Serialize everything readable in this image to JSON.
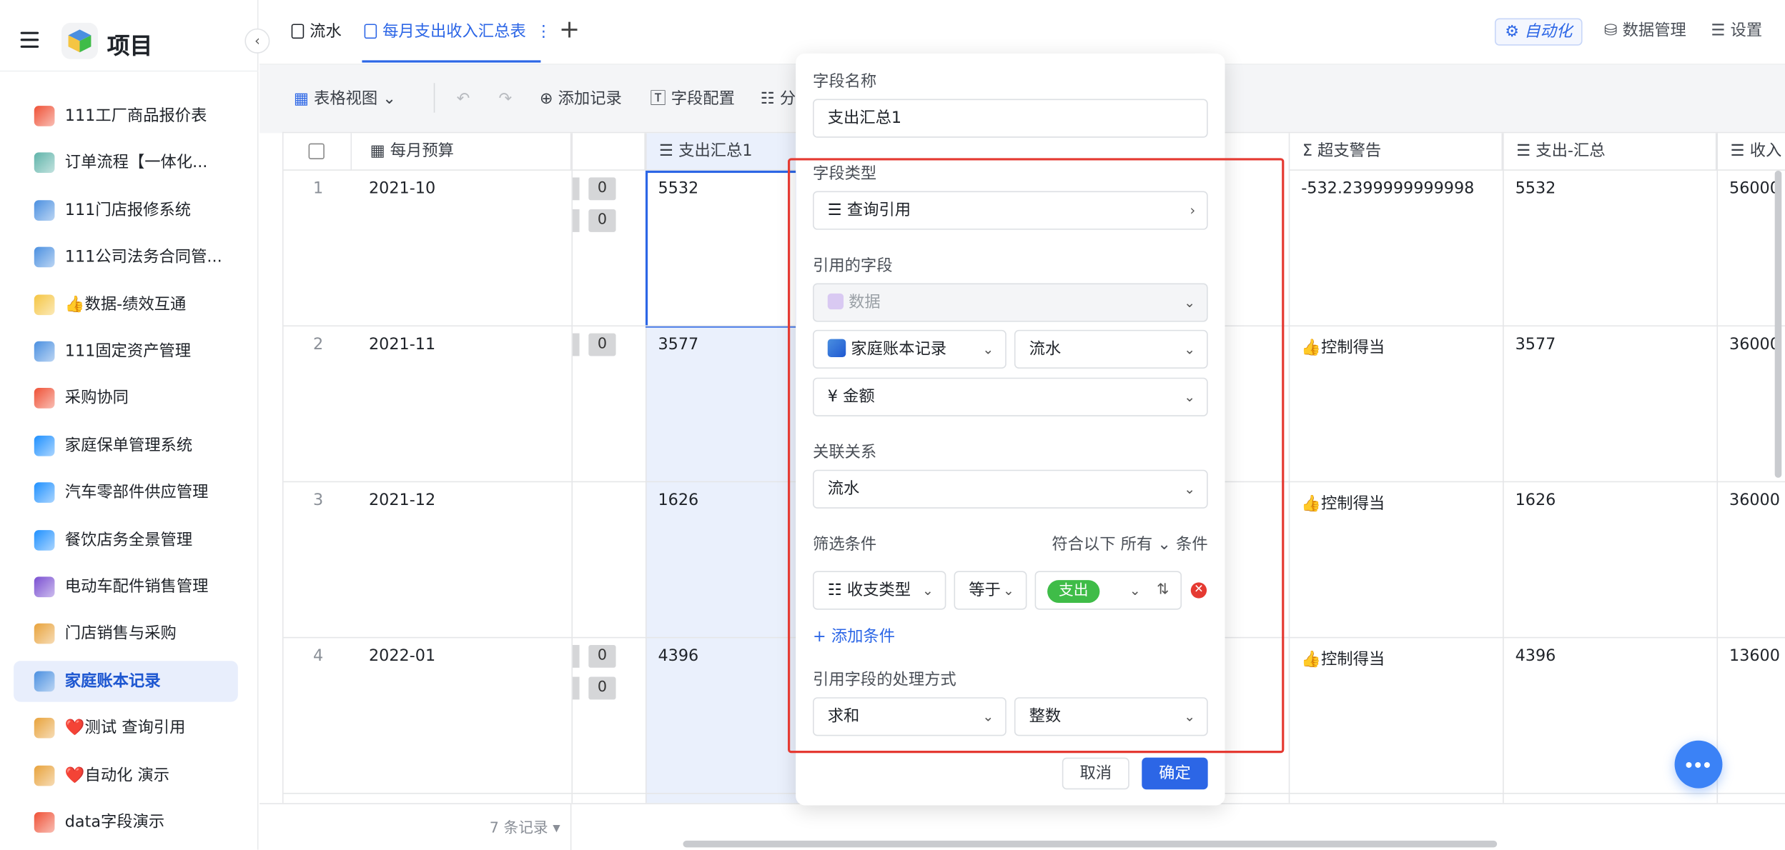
{
  "app": {
    "project_title": "项目"
  },
  "sidebar": {
    "items": [
      {
        "label": "111工厂商品报价表",
        "color": "#ef5136"
      },
      {
        "label": "订单流程【一体化...",
        "color": "#5fb3a9"
      },
      {
        "label": "111门店报修系统",
        "color": "#4a8fe0"
      },
      {
        "label": "111公司法务合同管...",
        "color": "#4a8fe0"
      },
      {
        "label": "👍数据-绩效互通",
        "color": "#f5c542"
      },
      {
        "label": "111固定资产管理",
        "color": "#4a8fe0"
      },
      {
        "label": "采购协同",
        "color": "#ef5136"
      },
      {
        "label": "家庭保单管理系统",
        "color": "#1e90ff"
      },
      {
        "label": "汽车零部件供应管理",
        "color": "#1e90ff"
      },
      {
        "label": "餐饮店务全景管理",
        "color": "#1e90ff"
      },
      {
        "label": "电动车配件销售管理",
        "color": "#7a4fd1"
      },
      {
        "label": "门店销售与采购",
        "color": "#e8a23b"
      },
      {
        "label": "家庭账本记录",
        "color": "#4a8fe0",
        "active": true
      },
      {
        "label": "❤️测试 查询引用",
        "color": "#e8a23b"
      },
      {
        "label": "❤️自动化 演示",
        "color": "#e8a23b"
      },
      {
        "label": "data字段演示",
        "color": "#ef5136"
      }
    ]
  },
  "tabs": {
    "items": [
      "流水",
      "每月支出收入汇总表"
    ],
    "more": "⋮",
    "add": "+"
  },
  "topright": {
    "automation": "自动化",
    "data_manage": "数据管理",
    "settings": "设置"
  },
  "toolbar": {
    "view": "表格视图",
    "undo": "↶",
    "redo": "↷",
    "add_record": "添加记录",
    "field_config": "字段配置",
    "group": "分"
  },
  "grid": {
    "headers": {
      "month_budget": "每月预算",
      "expense_total1": "支出汇总1",
      "over_warning": "超支警告",
      "expense_sum": "支出-汇总",
      "income": "收入"
    },
    "rows": [
      {
        "num": "1",
        "month": "2021-10",
        "expense": "5532",
        "warning": "-532.2399999999998",
        "exp_sum": "5532",
        "income": "56000"
      },
      {
        "num": "2",
        "month": "2021-11",
        "expense": "3577",
        "warning": "👍控制得当",
        "exp_sum": "3577",
        "income": "36000"
      },
      {
        "num": "3",
        "month": "2021-12",
        "expense": "1626",
        "warning": "👍控制得当",
        "exp_sum": "1626",
        "income": "36000"
      },
      {
        "num": "4",
        "month": "2022-01",
        "expense": "4396",
        "warning": "👍控制得当",
        "exp_sum": "4396",
        "income": "13600"
      }
    ],
    "zero": "0",
    "record_count": "7 条记录"
  },
  "panel": {
    "field_name_label": "字段名称",
    "field_name_value": "支出汇总1",
    "field_type_label": "字段类型",
    "field_type_value": "查询引用",
    "ref_field_label": "引用的字段",
    "ref_data": "数据",
    "ref_table": "家庭账本记录",
    "ref_sheet": "流水",
    "ref_column": "金额",
    "relation_label": "关联关系",
    "relation_value": "流水",
    "filter_label": "筛选条件",
    "filter_match_prefix": "符合以下",
    "filter_match_mode": "所有",
    "filter_match_suffix": "条件",
    "cond_field": "收支类型",
    "cond_op": "等于",
    "cond_value": "支出",
    "add_condition": "添加条件",
    "process_label": "引用字段的处理方式",
    "process_method": "求和",
    "process_format": "整数",
    "cancel": "取消",
    "confirm": "确定"
  },
  "colors": {
    "accent": "#2c66e6",
    "highlight_border": "#e53a32",
    "tag_green": "#3fbc48"
  }
}
